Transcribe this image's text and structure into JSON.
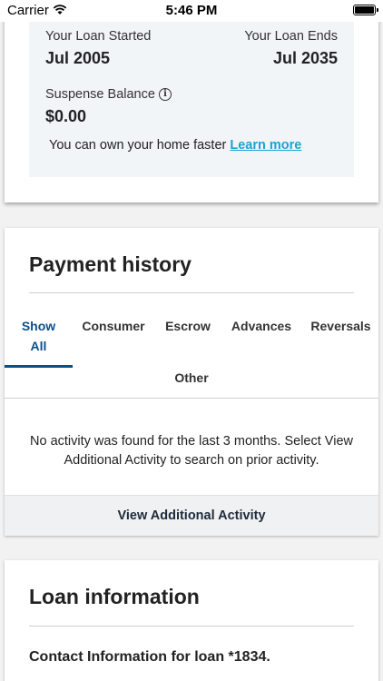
{
  "status_bar": {
    "carrier": "Carrier",
    "time": "5:46 PM"
  },
  "loan_summary": {
    "started_label": "Your Loan Started",
    "started_value": "Jul 2005",
    "ends_label": "Your Loan Ends",
    "ends_value": "Jul 2035",
    "suspense_label": "Suspense Balance",
    "suspense_value": "$0.00",
    "promo_text": "You can own your home faster",
    "promo_link": "Learn more"
  },
  "payment_history": {
    "title": "Payment history",
    "tabs": [
      {
        "label_line1": "Show",
        "label_line2": "All",
        "active": true
      },
      {
        "label": "Consumer"
      },
      {
        "label": "Escrow"
      },
      {
        "label": "Advances"
      },
      {
        "label": "Reversals"
      },
      {
        "label": "Other"
      }
    ],
    "empty_message": "No activity was found for the last 3 months. Select View Additional Activity to search on prior activity.",
    "view_button": "View Additional Activity"
  },
  "loan_information": {
    "title": "Loan information",
    "contact_heading": "Contact Information for loan *1834."
  },
  "colors": {
    "accent": "#0b4f8a",
    "link": "#1aa3d1",
    "summary_bg": "#f1f5f8"
  }
}
